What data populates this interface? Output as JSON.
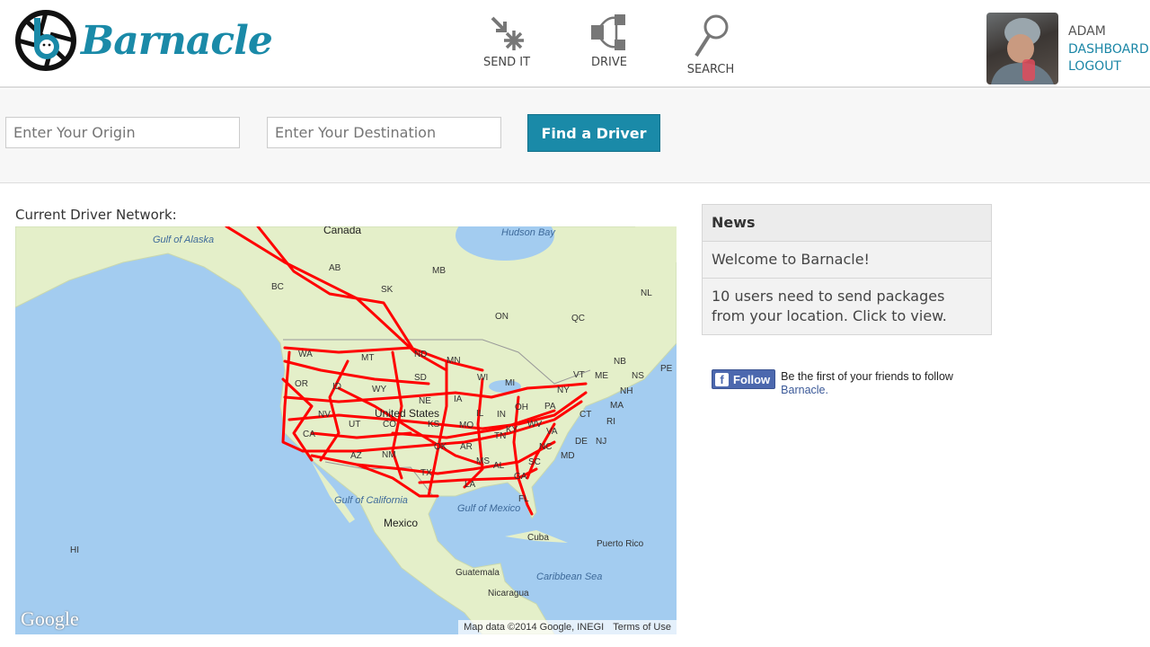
{
  "header": {
    "brand": "Barnacle",
    "nav": [
      {
        "label": "SEND IT",
        "icon": "send-it-icon"
      },
      {
        "label": "DRIVE",
        "icon": "drive-icon"
      },
      {
        "label": "SEARCH",
        "icon": "search-icon"
      }
    ],
    "user": {
      "name": "ADAM",
      "dashboard": "DASHBOARD",
      "logout": "LOGOUT"
    }
  },
  "search": {
    "origin_placeholder": "Enter Your Origin",
    "destination_placeholder": "Enter Your Destination",
    "button": "Find a Driver"
  },
  "map": {
    "heading": "Current Driver Network:",
    "labels": [
      "Canada",
      "Gulf of Alaska",
      "Hudson Bay",
      "AB",
      "BC",
      "SK",
      "MB",
      "ON",
      "QC",
      "NL",
      "NB",
      "NS",
      "PE",
      "WA",
      "MT",
      "ND",
      "MN",
      "OR",
      "ID",
      "WY",
      "SD",
      "WI",
      "MI",
      "NE",
      "IA",
      "NV",
      "UT",
      "CO",
      "KS",
      "MO",
      "IL",
      "IN",
      "OH",
      "CA",
      "AZ",
      "NM",
      "OK",
      "AR",
      "TN",
      "KY",
      "WV",
      "VA",
      "NC",
      "SC",
      "GA",
      "AL",
      "MS",
      "LA",
      "TX",
      "FL",
      "PA",
      "NY",
      "VT",
      "ME",
      "NH",
      "MA",
      "CT",
      "RI",
      "NJ",
      "DE",
      "MD",
      "United States",
      "Mexico",
      "Gulf of California",
      "Gulf of Mexico",
      "Cuba",
      "Puerto Rico",
      "Guatemala",
      "Caribbean Sea",
      "Nicaragua",
      "HI"
    ],
    "attribution": "Map data ©2014 Google, INEGI",
    "terms": "Terms of Use",
    "provider": "Google",
    "route_color": "#ff0000",
    "land_color": "#e4efc9",
    "water_color": "#a3ccf0"
  },
  "news": {
    "title": "News",
    "items": [
      "Welcome to Barnacle!",
      "10 users need to send packages from your location. Click to view."
    ]
  },
  "facebook": {
    "button": "Follow",
    "text": "Be the first of your friends to follow",
    "link": "Barnacle."
  },
  "colors": {
    "brand": "#1a8aa8"
  }
}
